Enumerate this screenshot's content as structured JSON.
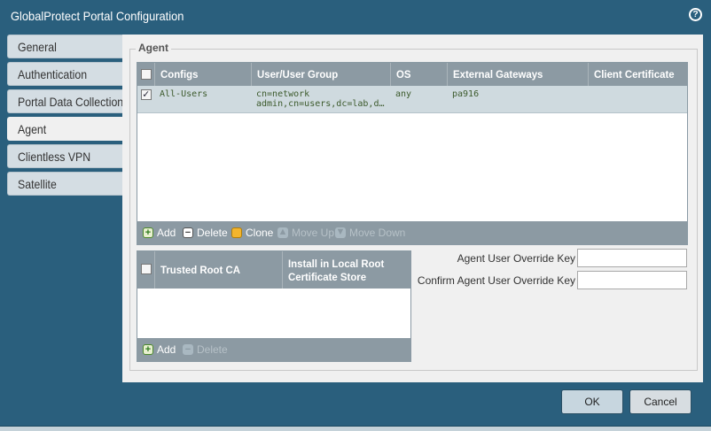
{
  "window": {
    "title": "GlobalProtect Portal Configuration",
    "help_icon": "?"
  },
  "tabs": [
    {
      "label": "General",
      "active": false
    },
    {
      "label": "Authentication",
      "active": false
    },
    {
      "label": "Portal Data Collection",
      "active": false
    },
    {
      "label": "Agent",
      "active": true
    },
    {
      "label": "Clientless VPN",
      "active": false
    },
    {
      "label": "Satellite",
      "active": false
    }
  ],
  "agent": {
    "legend": "Agent",
    "configs_table": {
      "headers": [
        "Configs",
        "User/User Group",
        "OS",
        "External Gateways",
        "Client Certificate"
      ],
      "rows": [
        {
          "checked": true,
          "config": "All-Users",
          "user_group_line1": "cn=network",
          "user_group_line2": "admin,cn=users,dc=lab,dc=...",
          "os": "any",
          "external_gateways": "pa916",
          "client_certificate": ""
        }
      ],
      "toolbar": {
        "add": "Add",
        "delete": "Delete",
        "clone": "Clone",
        "move_up": "Move Up",
        "move_down": "Move Down"
      }
    },
    "root_ca_table": {
      "headers": [
        "Trusted Root CA",
        "Install in Local Root Certificate Store"
      ],
      "header_line1": "Install in Local Root",
      "header_line2": "Certificate Store",
      "toolbar": {
        "add": "Add",
        "delete": "Delete"
      }
    },
    "override_key": {
      "label": "Agent User Override Key",
      "value": ""
    },
    "confirm_override_key": {
      "label": "Confirm Agent User Override Key",
      "value": ""
    }
  },
  "buttons": {
    "ok": "OK",
    "cancel": "Cancel"
  },
  "colors": {
    "titlebar": "#2a5f7d",
    "grid_header": "#8c9aa3",
    "selected_row": "#cfdadf"
  }
}
